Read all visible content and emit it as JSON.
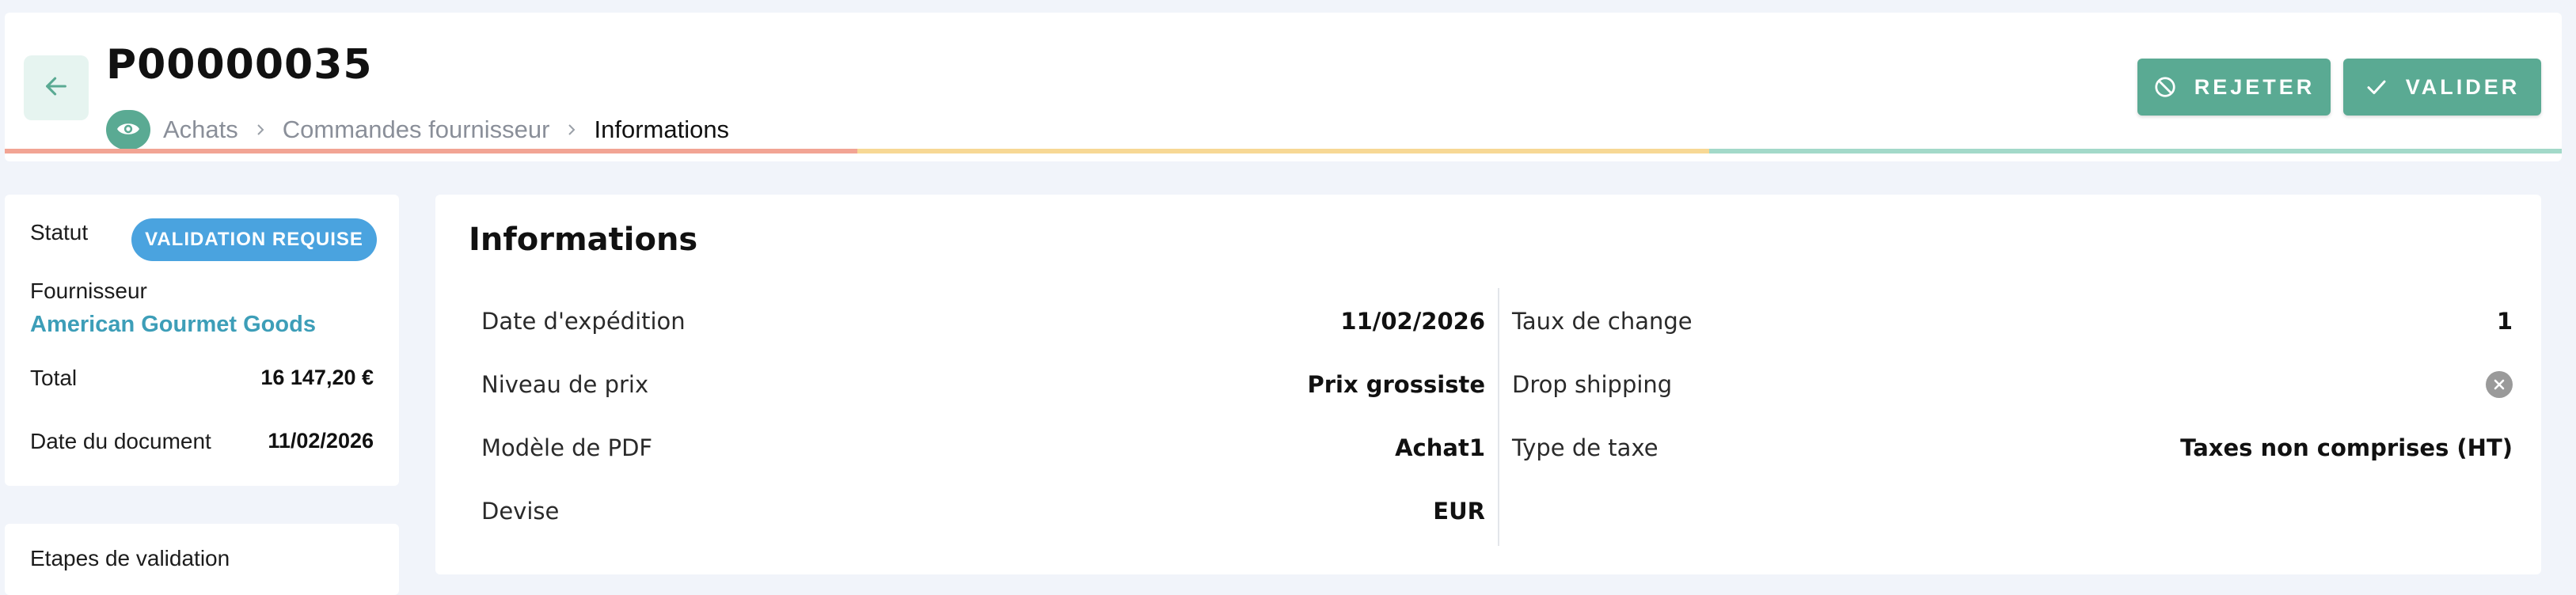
{
  "header": {
    "doc_number": "P00000035",
    "breadcrumb": [
      "Achats",
      "Commandes fournisseur",
      "Informations"
    ],
    "reject_label": "REJETER",
    "validate_label": "VALIDER",
    "progress_colors": [
      "#f2a494",
      "#f7d895",
      "#a3d9c9"
    ]
  },
  "summary": {
    "status_label": "Statut",
    "status_value": "VALIDATION REQUISE",
    "supplier_label": "Fournisseur",
    "supplier_value": "American Gourmet Goods",
    "total_label": "Total",
    "total_value": "16 147,20 €",
    "date_label": "Date du document",
    "date_value": "11/02/2026"
  },
  "steps": {
    "title": "Etapes de validation"
  },
  "info": {
    "title": "Informations",
    "left_rows": [
      {
        "label": "Date d'expédition",
        "value": "11/02/2026"
      },
      {
        "label": "Niveau de prix",
        "value": "Prix grossiste"
      },
      {
        "label": "Modèle de PDF",
        "value": "Achat1"
      },
      {
        "label": "Devise",
        "value": "EUR"
      }
    ],
    "right_rows": [
      {
        "label": "Taux de change",
        "value": "1"
      },
      {
        "label": "Drop shipping",
        "value_icon": "x-circle-icon",
        "enabled": false
      },
      {
        "label": "Type de taxe",
        "value": "Taxes non comprises (HT)"
      }
    ]
  },
  "colors": {
    "accent": "#5aaa93",
    "status_badge": "#4aa3df",
    "link": "#3d9eb8",
    "background": "#f1f4fa"
  }
}
